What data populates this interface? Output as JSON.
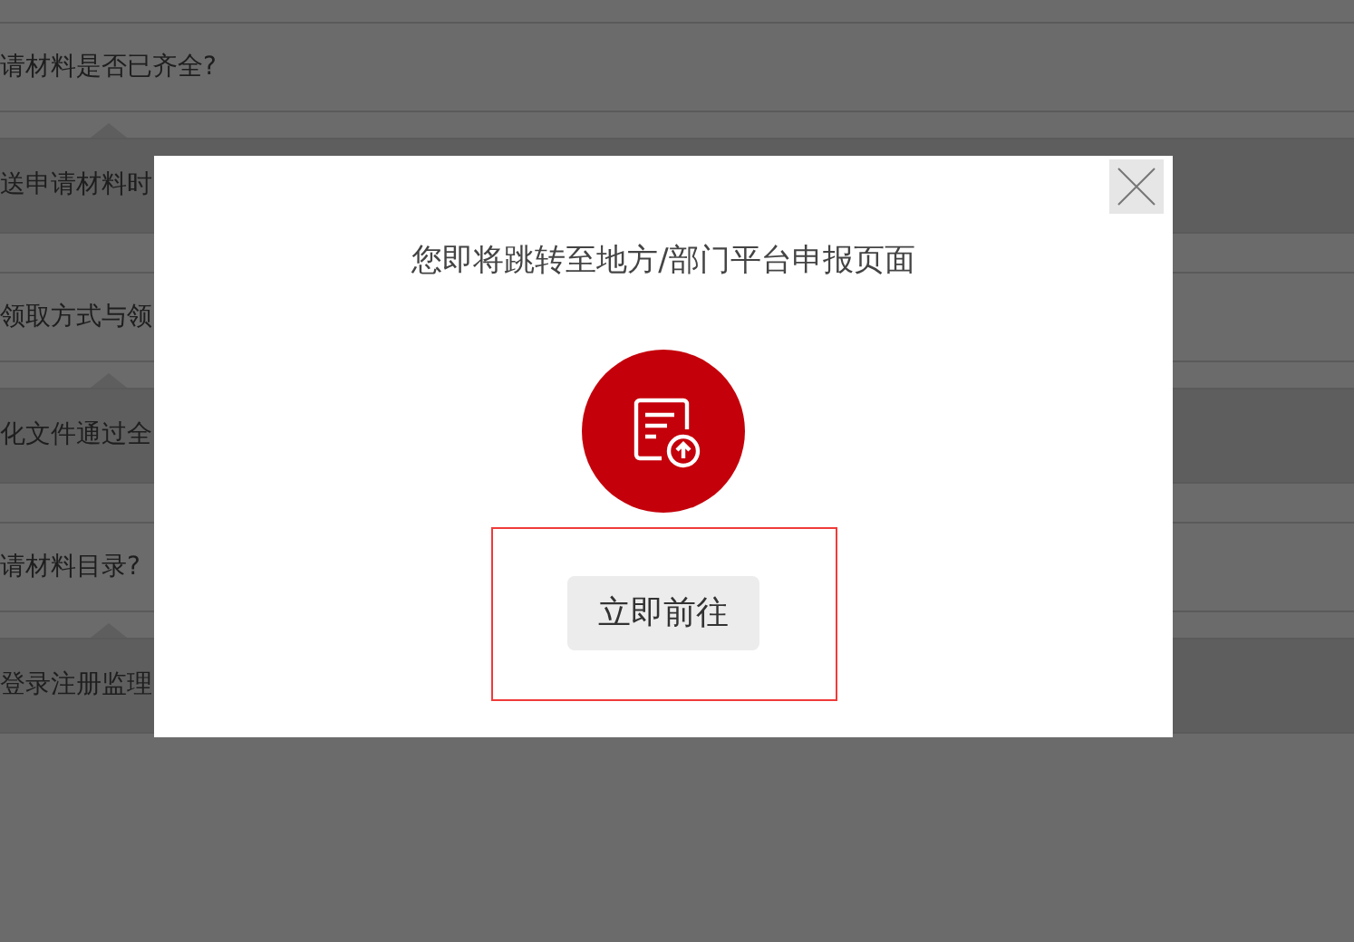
{
  "faq_items": [
    {
      "question": "请材料是否已齐全?",
      "kind": "plain"
    },
    {
      "question": "送申请材料时",
      "kind": "shaded"
    },
    {
      "question": "领取方式与领",
      "kind": "plain"
    },
    {
      "question": "化文件通过全",
      "kind": "shaded"
    },
    {
      "question": "请材料目录?",
      "kind": "plain"
    },
    {
      "question": "登录注册监理",
      "kind": "shaded"
    }
  ],
  "dialog": {
    "message": "您即将跳转至地方/部门平台申报页面",
    "button": "立即前往"
  }
}
